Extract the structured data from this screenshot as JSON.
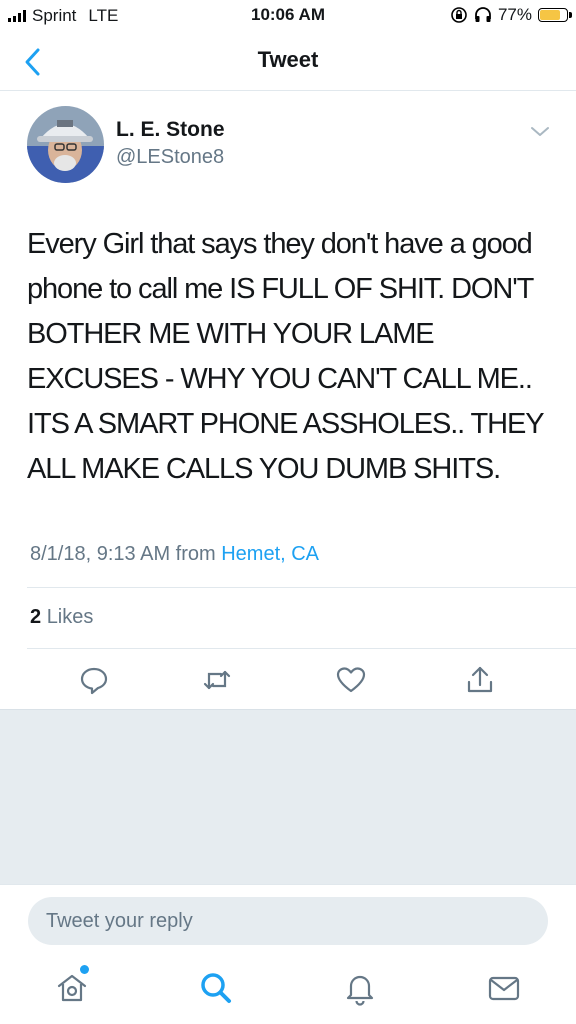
{
  "status_bar": {
    "carrier": "Sprint",
    "network": "LTE",
    "time": "10:06 AM",
    "battery_percent": "77%",
    "battery_level": 0.77,
    "battery_color": "#f6c544"
  },
  "nav": {
    "title": "Tweet",
    "back_icon": "chevron-left-icon"
  },
  "tweet": {
    "author_name": "L. E. Stone",
    "author_handle": "@LEStone8",
    "text": "Every Girl that says they don't have a good phone to call me IS FULL OF SHIT. DON'T BOTHER ME WITH YOUR LAME EXCUSES - WHY YOU CAN'T CALL ME.. ITS A SMART PHONE ASSHOLES..  THEY ALL MAKE CALLS YOU DUMB SHITS.",
    "timestamp": "8/1/18, 9:13 AM from",
    "location": "Hemet, CA",
    "likes_count": "2",
    "likes_label": "Likes"
  },
  "actions": [
    {
      "name": "reply",
      "icon": "comment-icon"
    },
    {
      "name": "retweet",
      "icon": "retweet-icon"
    },
    {
      "name": "like",
      "icon": "heart-icon"
    },
    {
      "name": "share",
      "icon": "share-icon"
    }
  ],
  "reply": {
    "placeholder": "Tweet your reply"
  },
  "tab_bar": [
    {
      "name": "home",
      "icon": "home-icon",
      "has_notification_dot": true
    },
    {
      "name": "search",
      "icon": "search-icon"
    },
    {
      "name": "notifications",
      "icon": "bell-icon"
    },
    {
      "name": "messages",
      "icon": "mail-icon"
    }
  ],
  "colors": {
    "accent": "#1da1f2",
    "muted_text": "#657786",
    "divider": "#e1e8ed",
    "empty_background": "#e6ecf0"
  }
}
